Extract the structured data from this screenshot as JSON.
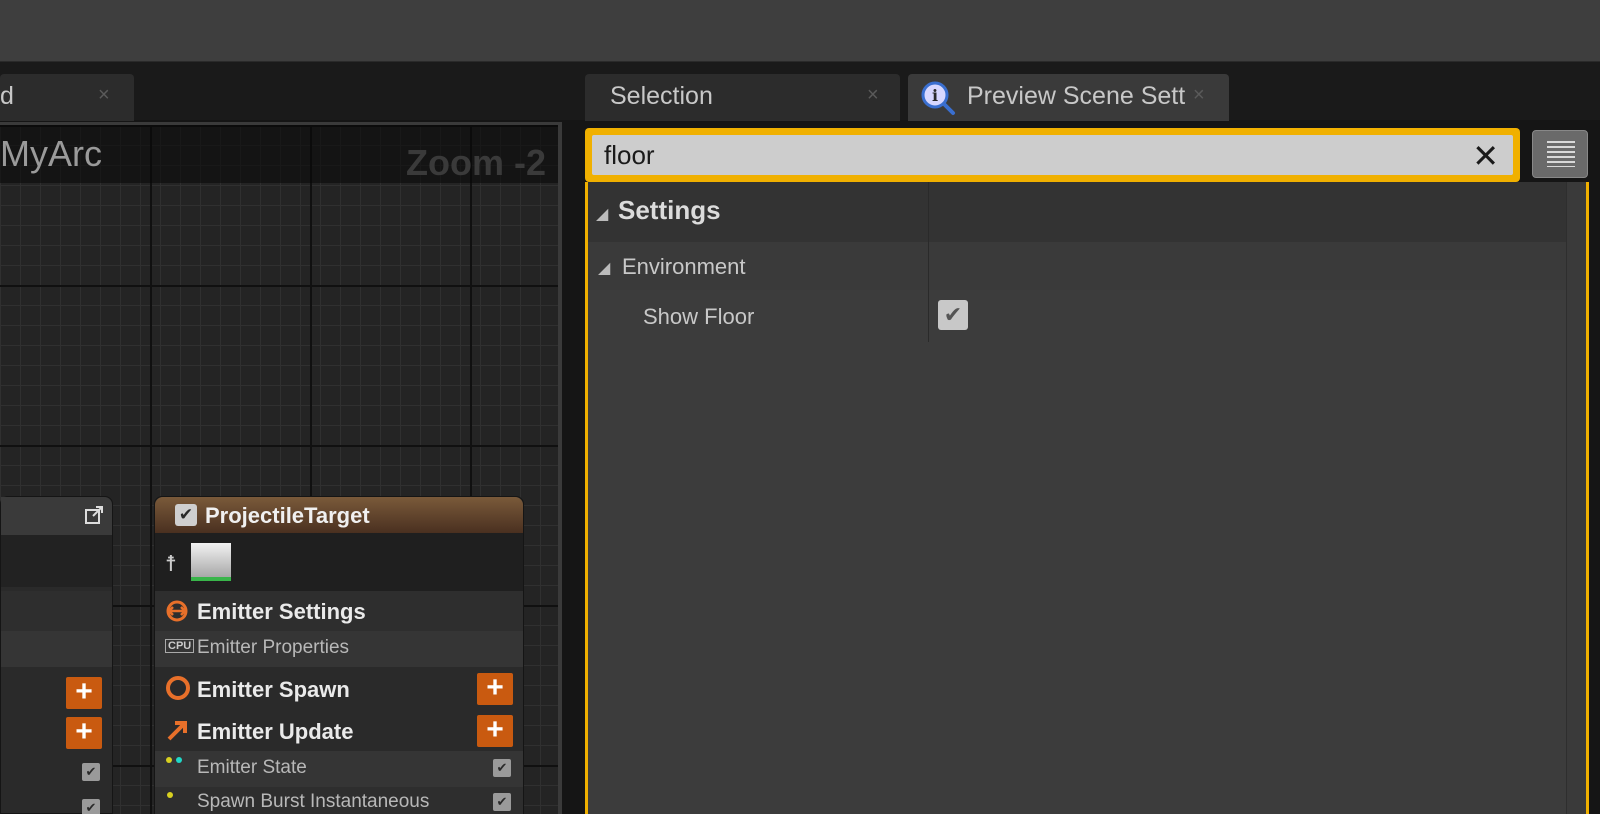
{
  "tabs": {
    "left_label": "d",
    "selection_label": "Selection",
    "preview_label": "Preview Scene Sett",
    "close_glyph": "×"
  },
  "graph": {
    "title": "MyArc",
    "zoom": "Zoom -2"
  },
  "node": {
    "title": "ProjectileTarget",
    "rows": {
      "emitter_settings": "Emitter Settings",
      "emitter_properties": "Emitter Properties",
      "emitter_spawn": "Emitter Spawn",
      "emitter_update": "Emitter Update",
      "emitter_state": "Emitter State",
      "spawn_burst": "Spawn Burst Instantaneous"
    },
    "plus": "+",
    "check": "✔"
  },
  "search": {
    "value": "floor",
    "clear": "✕"
  },
  "details": {
    "category": "Settings",
    "subcategory": "Environment",
    "property": "Show Floor",
    "property_checked": true,
    "check": "✔",
    "triangle": "◢"
  },
  "colors": {
    "accent": "#f0b000",
    "node_header": "#7a5a3a",
    "plus_button": "#c95a10"
  }
}
